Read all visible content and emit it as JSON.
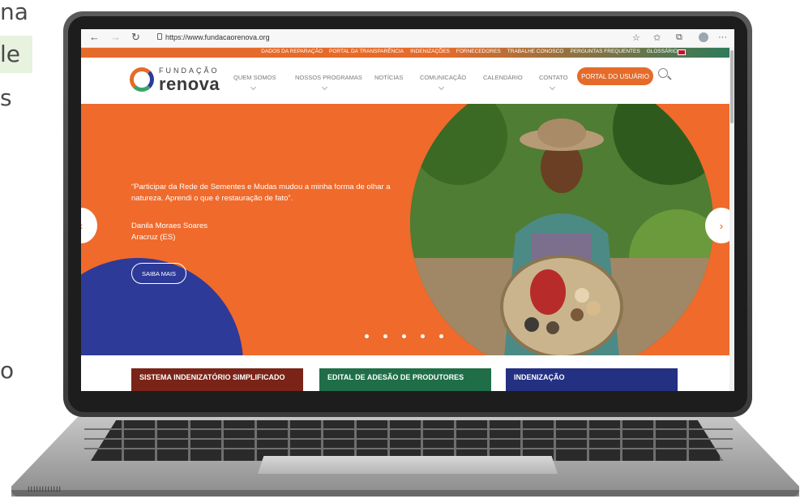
{
  "background_text": {
    "line1": "na",
    "line2": "le",
    "line3": "s",
    "line4": "o"
  },
  "browser": {
    "back": "←",
    "forward": "→",
    "reload": "↻",
    "url": "https://www.fundacaorenova.org",
    "icons": [
      "star-icon",
      "favorites-icon",
      "collections-icon",
      "profile-icon",
      "more-icon"
    ],
    "more": "···"
  },
  "topbar": {
    "links": [
      "DADOS DA REPARAÇÃO",
      "PORTAL DA TRANSPARÊNCIA",
      "INDENIZAÇÕES",
      "FORNECEDORES",
      "TRABALHE CONOSCO",
      "PERGUNTAS FREQUENTES",
      "GLOSSÁRIO"
    ]
  },
  "header": {
    "logo_top": "FUNDAÇÃO",
    "logo_name": "renova",
    "menu": [
      "QUEM SOMOS",
      "NOSSOS PROGRAMAS",
      "NOTÍCIAS",
      "COMUNICAÇÃO",
      "CALENDÁRIO",
      "CONTATO"
    ],
    "portal_button": "PORTAL DO USUÁRIO"
  },
  "hero": {
    "quote": "“Participar da Rede de Sementes e Mudas mudou a minha forma de olhar a natureza. Aprendi o que é restauração de fato”.",
    "author_name": "Danila Moraes Soares",
    "author_place": "Aracruz (ES)",
    "cta": "SAIBA MAIS",
    "prev": "‹",
    "next": "›"
  },
  "cards": [
    {
      "label": "SISTEMA INDENIZATÓRIO SIMPLIFICADO",
      "color": "#7a2418"
    },
    {
      "label": "EDITAL DE ADESÃO DE PRODUTORES",
      "color": "#1f6e48"
    },
    {
      "label": "INDENIZAÇÃO",
      "color": "#243082"
    }
  ],
  "colors": {
    "brand_orange": "#ef6a2b",
    "brand_blue": "#2e3a98",
    "brand_green": "#2c7a5a"
  },
  "keyboard": {
    "vent": "IIIIIIIIIIII"
  }
}
